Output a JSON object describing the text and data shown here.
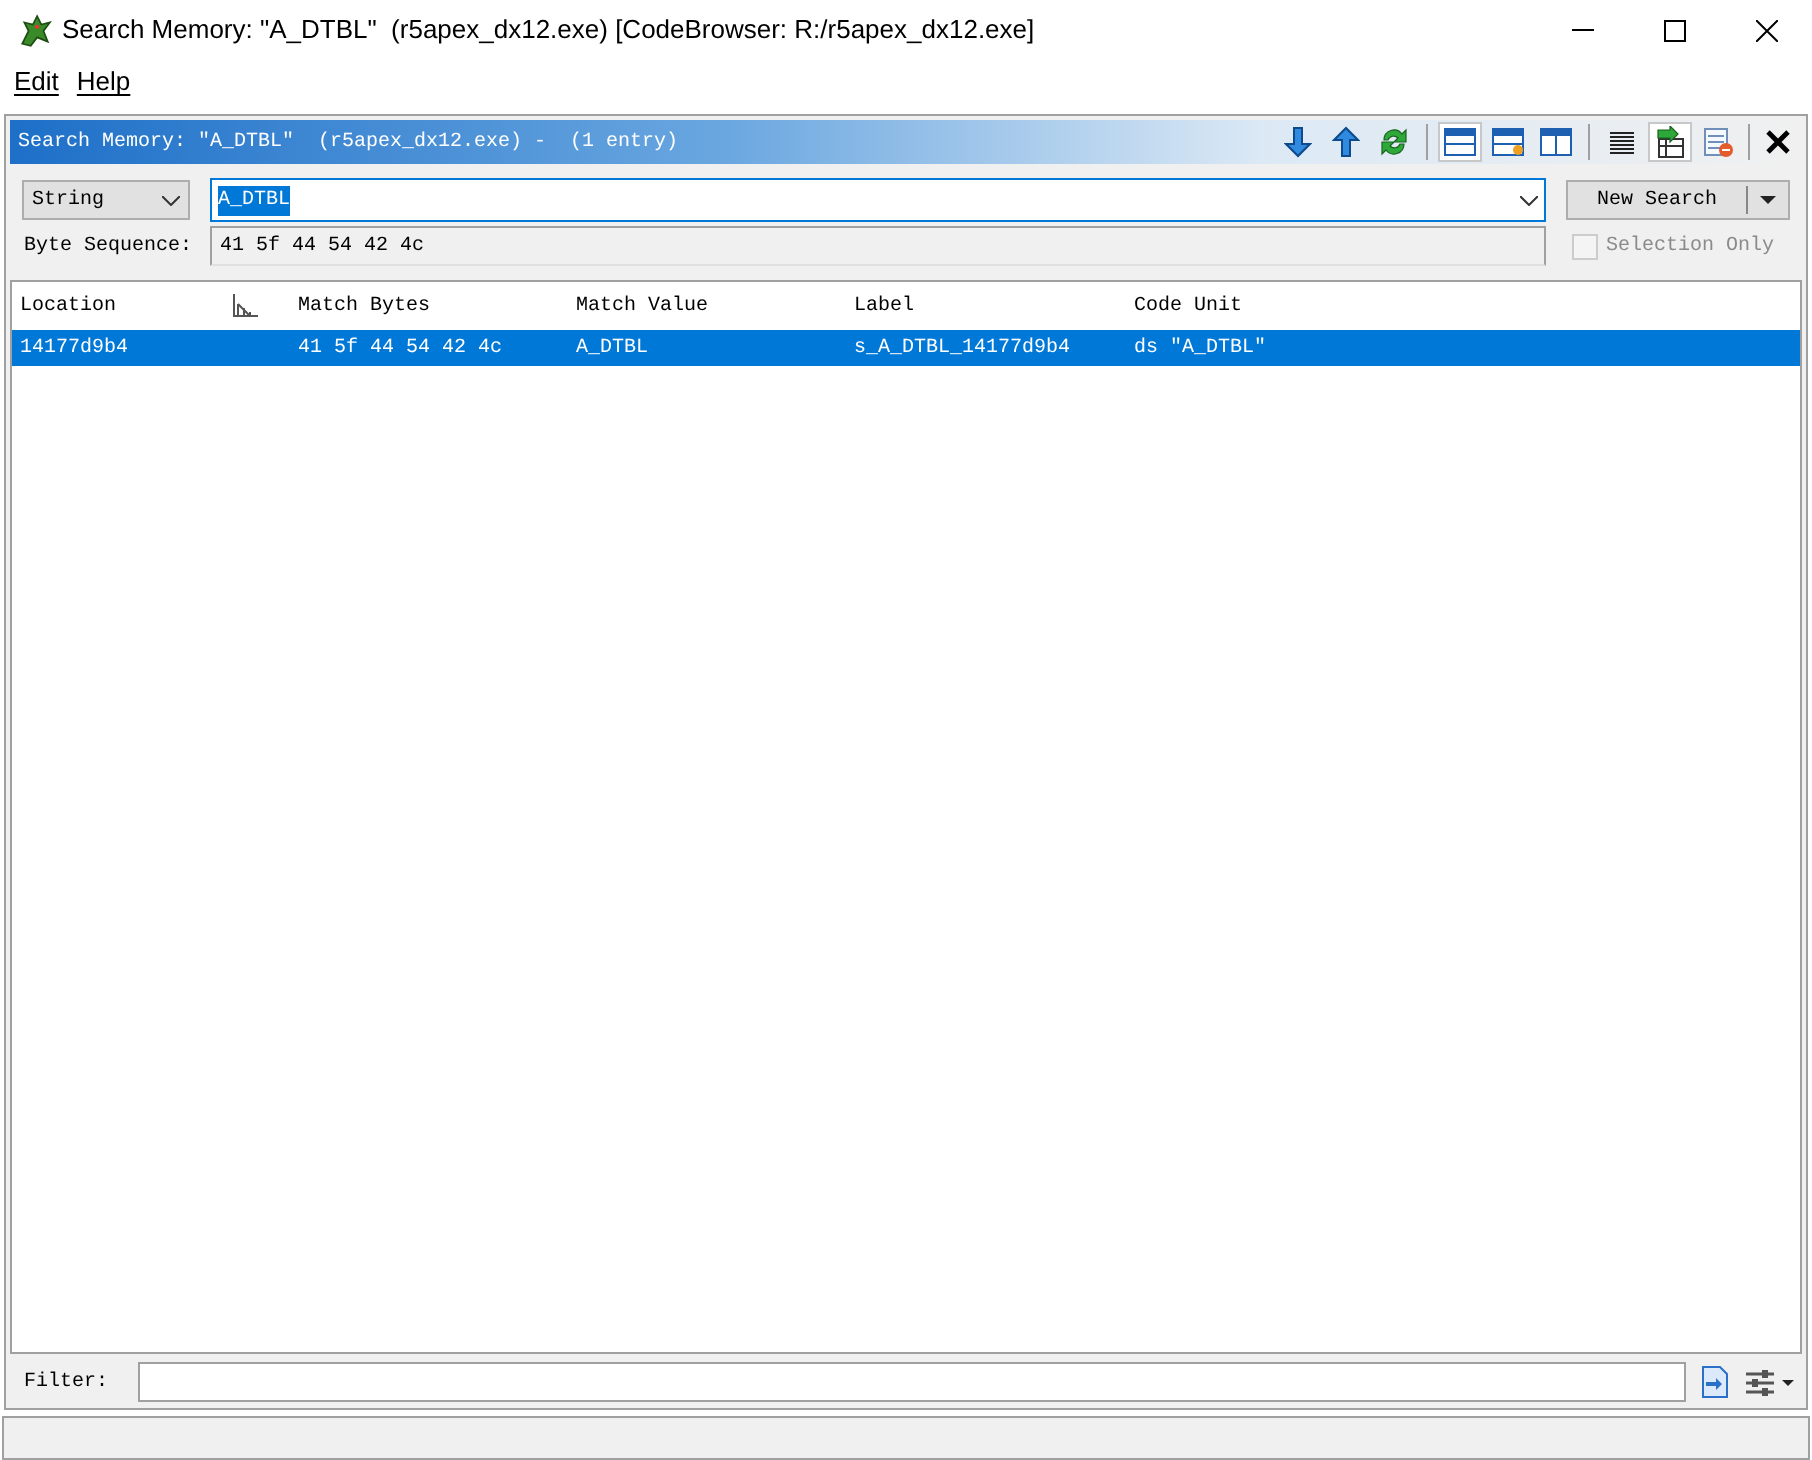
{
  "window": {
    "title": "Search Memory: \"A_DTBL\"  (r5apex_dx12.exe) [CodeBrowser: R:/r5apex_dx12.exe]"
  },
  "menu": [
    {
      "label": "Edit"
    },
    {
      "label": "Help"
    }
  ],
  "panel": {
    "title": "Search Memory: \"A_DTBL\"  (r5apex_dx12.exe) -  (1 entry)"
  },
  "search": {
    "format": "String",
    "value": "A_DTBL",
    "byte_sequence_label": "Byte Sequence:",
    "byte_sequence": "41 5f 44 54 42 4c",
    "button": "New Search",
    "selection_only": {
      "label": "Selection Only",
      "checked": false,
      "disabled": true
    }
  },
  "table": {
    "columns": [
      {
        "label": "Location",
        "sorted": true
      },
      {
        "label": "Match Bytes",
        "sorted": false
      },
      {
        "label": "Match Value",
        "sorted": false
      },
      {
        "label": "Label",
        "sorted": false
      },
      {
        "label": "Code Unit",
        "sorted": false
      }
    ],
    "rows": [
      {
        "selected": true,
        "cells": [
          "14177d9b4",
          "41 5f 44 54 42 4c",
          "A_DTBL",
          "s_A_DTBL_14177d9b4",
          "ds \"A_DTBL\""
        ]
      }
    ]
  },
  "filter": {
    "label": "Filter:"
  }
}
